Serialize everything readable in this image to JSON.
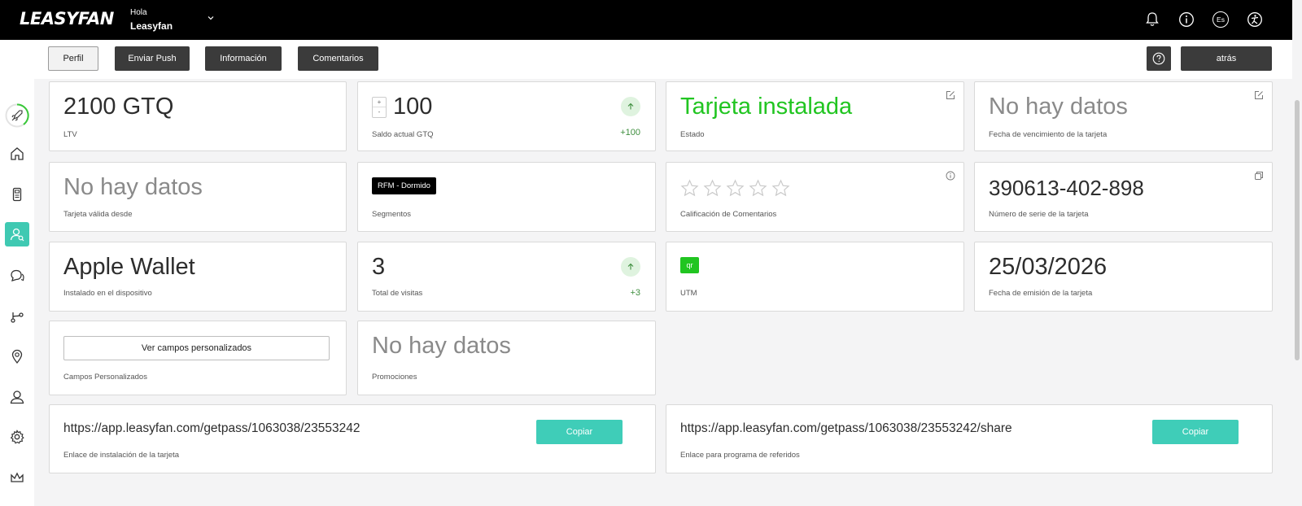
{
  "app": {
    "logo": "LEASYFAN",
    "greeting": "Hola",
    "user_name": "Leasyfan",
    "language": "Es"
  },
  "toolbar": {
    "perfil": "Perfil",
    "enviar_push": "Enviar Push",
    "informacion": "Información",
    "comentarios": "Comentarios",
    "atras": "atrás"
  },
  "cards": {
    "ltv": {
      "value": "2100 GTQ",
      "label": "LTV"
    },
    "saldo": {
      "value": "100",
      "label": "Saldo actual GTQ",
      "delta": "+100",
      "stepper_up": "+",
      "stepper_down": "-"
    },
    "estado": {
      "value": "Tarjeta instalada",
      "label": "Estado"
    },
    "vencimiento": {
      "value": "No hay datos",
      "label": "Fecha de vencimiento de la tarjeta"
    },
    "valida_desde": {
      "value": "No hay datos",
      "label": "Tarjeta válida desde"
    },
    "segmentos": {
      "badge": "RFM - Dormido",
      "label": "Segmentos"
    },
    "calificacion": {
      "stars_filled": 0,
      "stars_total": 5,
      "label": "Calificación de Comentarios"
    },
    "serie": {
      "value": "390613-402-898",
      "label": "Número de serie de la tarjeta"
    },
    "instalado": {
      "value": "Apple Wallet",
      "label": "Instalado en el dispositivo"
    },
    "visitas": {
      "value": "3",
      "label": "Total de visitas",
      "delta": "+3"
    },
    "utm": {
      "badge": "qr",
      "label": "UTM"
    },
    "emision": {
      "value": "25/03/2026",
      "label": "Fecha de emisión de la tarjeta"
    },
    "campos": {
      "button": "Ver campos personalizados",
      "label": "Campos Personalizados"
    },
    "promociones": {
      "value": "No hay datos",
      "label": "Promociones"
    },
    "enlace_instalacion": {
      "url": "https://app.leasyfan.com/getpass/1063038/23553242",
      "label": "Enlace de instalación de la tarjeta",
      "button": "Copiar"
    },
    "enlace_referidos": {
      "url": "https://app.leasyfan.com/getpass/1063038/23553242/share",
      "label": "Enlace para programa de referidos",
      "button": "Copiar"
    }
  },
  "colors": {
    "accent": "#3fc9b2",
    "installed_green": "#21c521",
    "topbar": "#000000"
  }
}
